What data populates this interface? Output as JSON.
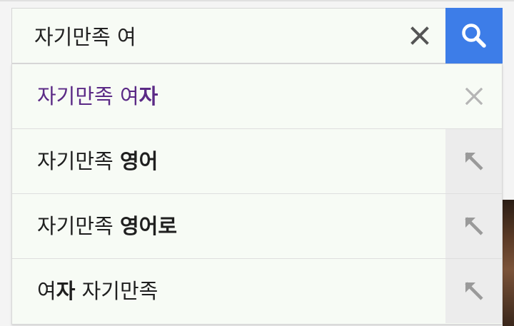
{
  "search": {
    "query": "자기만족 여",
    "clear_icon": "close-icon",
    "submit_icon": "search-icon",
    "accent_color": "#3d7de8"
  },
  "suggestions": [
    {
      "prefix": "자기만족 여",
      "bold": "자",
      "suffix": "",
      "state": "visited",
      "action_icon": "remove-icon",
      "action_color": "#b5b5b5"
    },
    {
      "prefix": "자기만족 ",
      "bold": "영어",
      "suffix": "",
      "state": "normal",
      "action_icon": "fill-query-arrow-icon",
      "action_color": "#9a9a9a"
    },
    {
      "prefix": "자기만족 ",
      "bold": "영어로",
      "suffix": "",
      "state": "normal",
      "action_icon": "fill-query-arrow-icon",
      "action_color": "#9a9a9a"
    },
    {
      "prefix": "여",
      "bold": "자",
      "suffix": " 자기만족",
      "state": "normal",
      "action_icon": "fill-query-arrow-icon",
      "action_color": "#9a9a9a"
    }
  ],
  "colors": {
    "visited_text": "#5b2a86",
    "text": "#1f1f1f",
    "panel_background": "#f7fbf5"
  }
}
